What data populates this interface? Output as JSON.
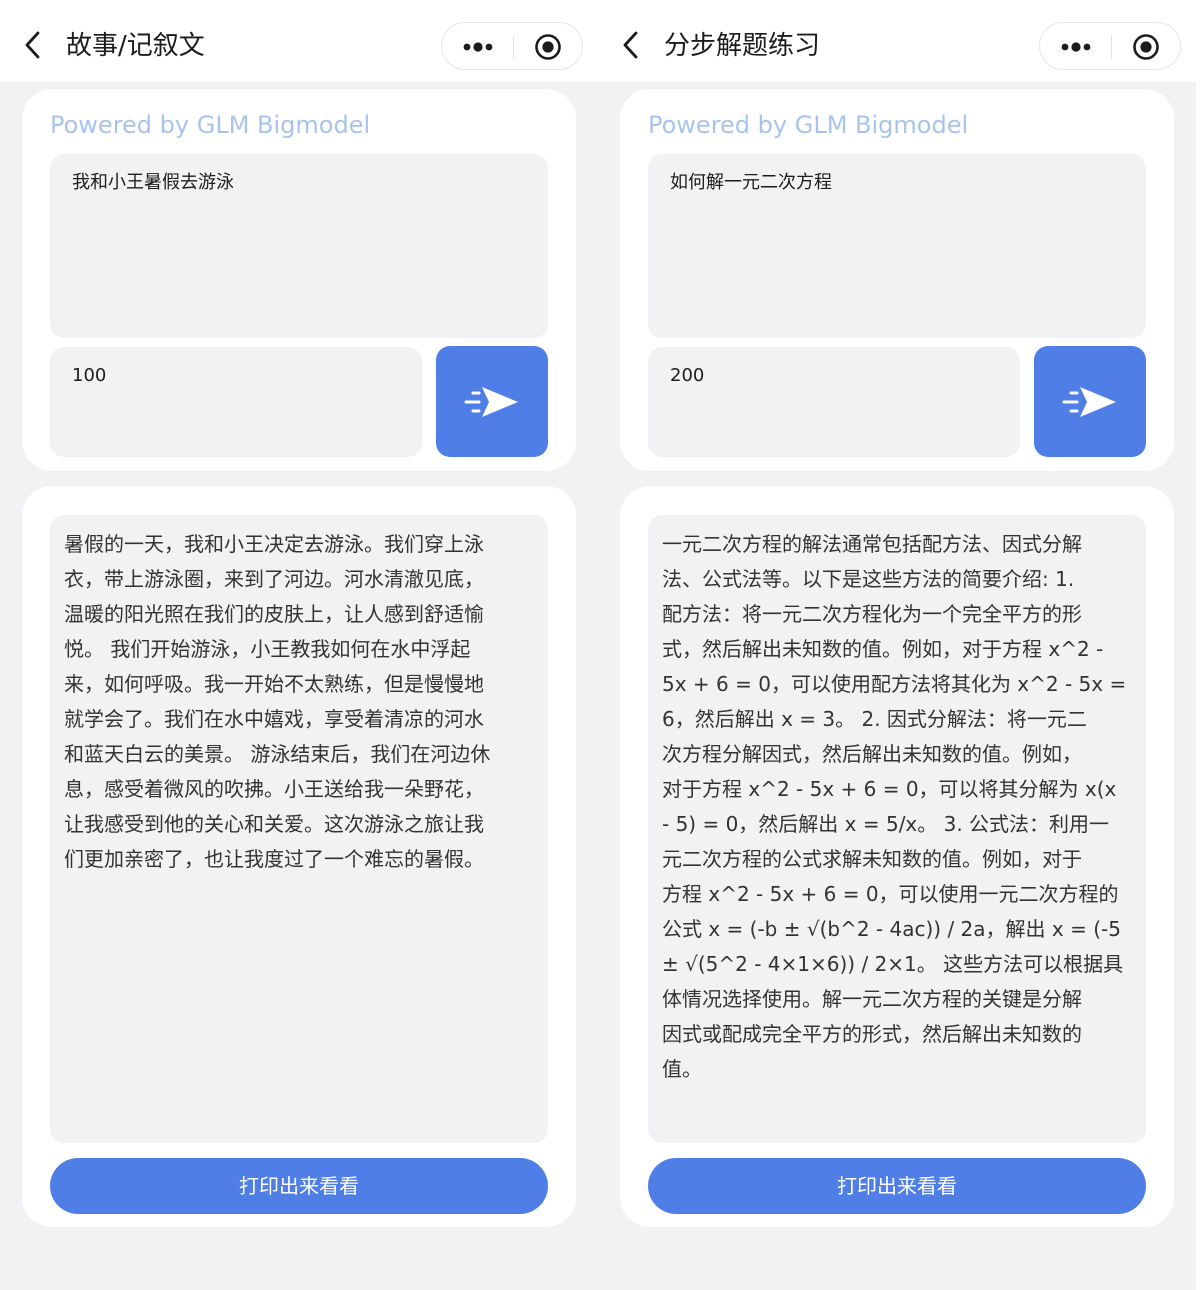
{
  "left": {
    "nav_title": "故事/记叙文",
    "powered_by": "Powered by GLM Bigmodel",
    "prompt_value": "我和小王暑假去游泳",
    "length_value": "100",
    "output_lines": [
      "暑假的一天，我和小王决定去游泳。我们穿上泳",
      "衣，带上游泳圈，来到了河边。河水清澈见底，",
      "温暖的阳光照在我们的皮肤上，让人感到舒适愉",
      "悦。 我们开始游泳，小王教我如何在水中浮起",
      "来，如何呼吸。我一开始不太熟练，但是慢慢地",
      "就学会了。我们在水中嬉戏，享受着清凉的河水",
      "和蓝天白云的美景。 游泳结束后，我们在河边休",
      "息，感受着微风的吹拂。小王送给我一朵野花，",
      "让我感受到他的关心和关爱。这次游泳之旅让我",
      "们更加亲密了，也让我度过了一个难忘的暑假。"
    ],
    "print_label": "打印出来看看"
  },
  "right": {
    "nav_title": "分步解题练习",
    "powered_by": "Powered by GLM Bigmodel",
    "prompt_value": "如何解一元二次方程",
    "length_value": "200",
    "output_lines": [
      "一元二次方程的解法通常包括配方法、因式分解",
      "法、公式法等。以下是这些方法的简要介绍: 1.",
      "配方法：将一元二次方程化为一个完全平方的形",
      "式，然后解出未知数的值。例如，对于方程 x^2 -",
      "5x + 6 = 0，可以使用配方法将其化为 x^2 - 5x =",
      "6，然后解出 x = 3。 2. 因式分解法：将一元二",
      "次方程分解因式，然后解出未知数的值。例如，",
      "对于方程 x^2 - 5x + 6 = 0，可以将其分解为 x(x",
      "- 5) = 0，然后解出 x = 5/x。 3. 公式法：利用一",
      "元二次方程的公式求解未知数的值。例如，对于",
      "方程 x^2 - 5x + 6 = 0，可以使用一元二次方程的",
      "公式 x = (-b ± √(b^2 - 4ac)) / 2a，解出 x = (-5",
      "± √(5^2 - 4×1×6)) / 2×1。 这些方法可以根据具",
      "体情况选择使用。解一元二次方程的关键是分解",
      "因式或配成完全平方的形式，然后解出未知数的",
      "值。"
    ],
    "print_label": "打印出来看看"
  },
  "colors": {
    "accent": "#4f7ee6",
    "powered_text": "#a8c3ee",
    "page_background": "#f2f2f4"
  },
  "icons": {
    "back": "chevron-left-icon",
    "more": "more-dots-icon",
    "close": "target-circle-icon",
    "send": "paper-plane-icon"
  }
}
